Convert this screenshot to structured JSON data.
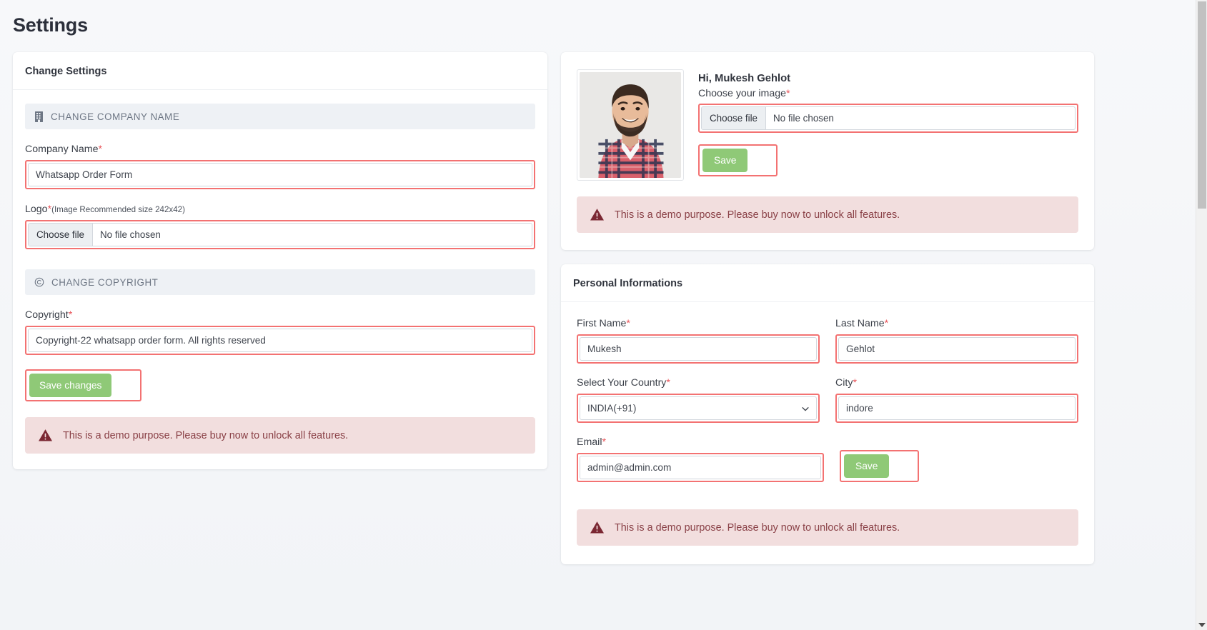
{
  "page": {
    "title": "Settings"
  },
  "colors": {
    "accent_green": "#8fc977",
    "highlight_red": "#f37272",
    "alert_bg": "#f2dede",
    "alert_text": "#8a4147",
    "section_bar_bg": "#eef1f5",
    "page_bg": "#f4f6f9"
  },
  "change_settings": {
    "card_title": "Change Settings",
    "section_company": {
      "icon": "building-icon",
      "label": "CHANGE COMPANY NAME"
    },
    "company_name": {
      "label": "Company Name",
      "required_mark": "*",
      "value": "Whatsapp Order Form"
    },
    "logo": {
      "label": "Logo",
      "required_mark": "*",
      "hint": "(Image Recommended size 242x42)",
      "choose_button": "Choose file",
      "file_status": "No file chosen"
    },
    "section_copyright": {
      "icon": "copyright-icon",
      "label": "CHANGE COPYRIGHT"
    },
    "copyright": {
      "label": "Copyright",
      "required_mark": "*",
      "value": "Copyright-22 whatsapp order form. All rights reserved"
    },
    "save_changes_label": "Save changes",
    "alert": {
      "icon": "warning-triangle-icon",
      "text": "This is a demo purpose. Please buy now to unlock all features."
    }
  },
  "profile": {
    "avatar": "user-photo",
    "greeting": "Hi, Mukesh Gehlot",
    "choose_image": {
      "label": "Choose your image",
      "required_mark": "*",
      "choose_button": "Choose file",
      "file_status": "No file chosen"
    },
    "save_label": "Save",
    "alert": {
      "icon": "warning-triangle-icon",
      "text": "This is a demo purpose. Please buy now to unlock all features."
    }
  },
  "personal_information": {
    "card_title": "Personal Informations",
    "fields": {
      "first_name": {
        "label": "First Name",
        "required_mark": "*",
        "value": "Mukesh"
      },
      "last_name": {
        "label": "Last Name",
        "required_mark": "*",
        "value": "Gehlot"
      },
      "country": {
        "label": "Select Your Country",
        "required_mark": "*",
        "value": "INDIA(+91)",
        "icon": "chevron-down-icon"
      },
      "city": {
        "label": "City",
        "required_mark": "*",
        "value": "indore"
      },
      "email": {
        "label": "Email",
        "required_mark": "*",
        "value": "admin@admin.com"
      }
    },
    "save_label": "Save",
    "alert": {
      "icon": "warning-triangle-icon",
      "text": "This is a demo purpose. Please buy now to unlock all features."
    }
  },
  "scrollbar": {
    "icon": "scroll-down-arrow-icon"
  }
}
